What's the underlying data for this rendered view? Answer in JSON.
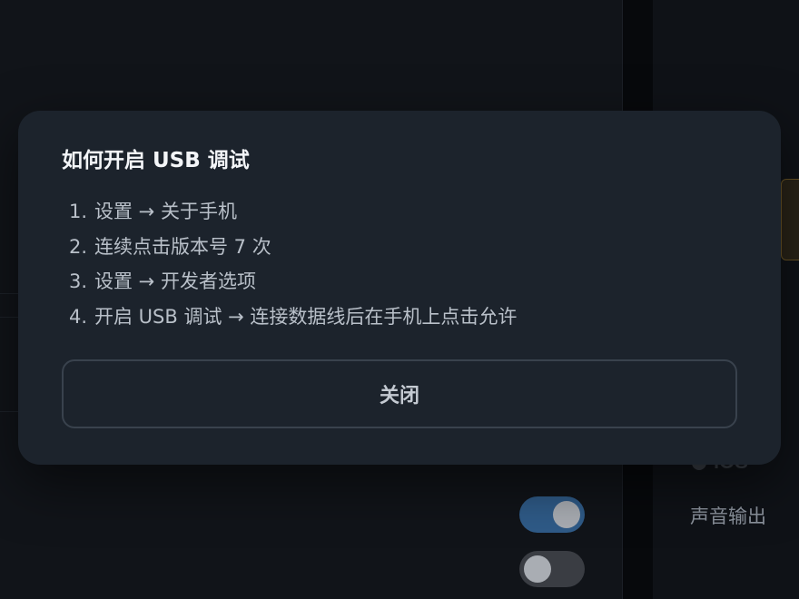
{
  "modal": {
    "title": "如何开启 USB 调试",
    "steps": [
      {
        "num": "1.",
        "text": "设置 → 关于手机"
      },
      {
        "num": "2.",
        "text": "连续点击版本号 7 次"
      },
      {
        "num": "3.",
        "text": "设置 → 开发者选项"
      },
      {
        "num": "4.",
        "text": "开启 USB 调试 → 连接数据线后在手机上点击允许"
      }
    ],
    "close_label": "关闭"
  },
  "background": {
    "ios_label": "iOS",
    "audio_label": "声音输出",
    "toggles": [
      {
        "state": "on"
      },
      {
        "state": "off"
      }
    ]
  },
  "colors": {
    "modal_bg": "#1c232c",
    "toggle_on": "#2f5b88",
    "toggle_off": "#3a3d43",
    "accent_border": "#6b5526"
  }
}
